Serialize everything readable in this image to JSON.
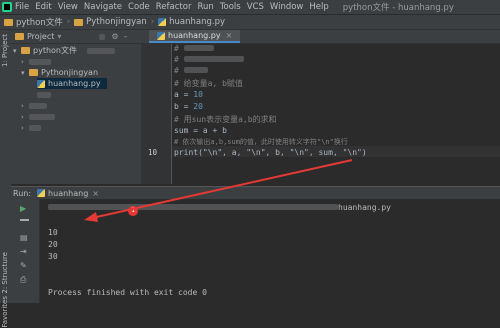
{
  "menubar": {
    "items": [
      "File",
      "Edit",
      "View",
      "Navigate",
      "Code",
      "Refactor",
      "Run",
      "Tools",
      "VCS",
      "Window",
      "Help"
    ],
    "window_title": "python文件 - huanhang.py"
  },
  "breadcrumb": {
    "project": "python文件",
    "folder": "Pythonjingyan",
    "file": "huanhang.py"
  },
  "left_stripe": {
    "project_tab": "1: Project",
    "structure_tab": "2: Structure",
    "favorites_tab": "Favorites"
  },
  "project_panel": {
    "title": "Project",
    "root": "python文件",
    "folder": "Pythonjingyan",
    "file": "huanhang.py"
  },
  "editor": {
    "tab_label": "huanhang.py",
    "line_number": "10",
    "lines": {
      "c1": "# 给变量a, b赋值",
      "a_var": "a",
      "a_val": "10",
      "b_var": "b",
      "b_val": "20",
      "c2": "# 用sun表示变量a,b的求和",
      "sum_line": "sum = a + b",
      "c3": "# 依次输出a,b,sum的值，此时使用转义字符\"\\n\"换行",
      "print_line": "print(\"\\n\", a, \"\\n\", b, \"\\n\", sum, \"\\n\")"
    }
  },
  "run_panel": {
    "tab_label": "Run:",
    "config": "huanhang",
    "cmd_suffix": "huanhang.py",
    "badge": "1",
    "output": [
      "10",
      "20",
      "30"
    ],
    "exit_message": "Process finished with exit code 0"
  },
  "colors": {
    "accent": "#4a88c7",
    "arrow": "#e53935"
  }
}
